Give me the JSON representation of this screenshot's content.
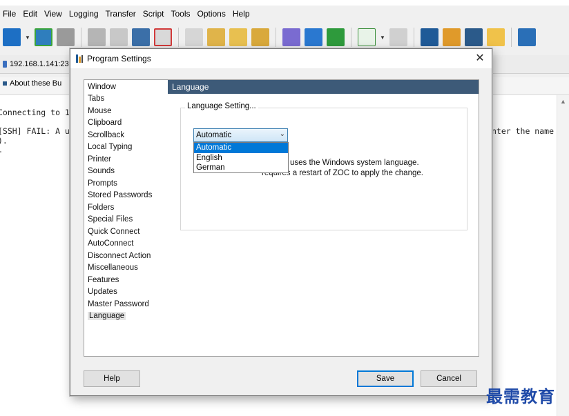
{
  "menubar": {
    "items": [
      "File",
      "Edit",
      "View",
      "Logging",
      "Transfer",
      "Script",
      "Tools",
      "Options",
      "Help"
    ]
  },
  "toolbar": {
    "icons": [
      "sort-az-icon",
      "connect-icon",
      "host-icon",
      "disconnect-icon",
      "close-connection-icon",
      "copy-icon",
      "delete-icon",
      "paste-icon",
      "clipboard-icon",
      "edit-icon",
      "clipboard-paste-icon",
      "download-icon",
      "upload-icon",
      "spellcheck-icon",
      "play-icon",
      "stop-icon",
      "add-icon",
      "settings-icon",
      "book-icon",
      "folder-icon",
      "terminal-icon"
    ]
  },
  "session": {
    "tab_label": "192.168.1.141:23",
    "button_label": "About these Bu"
  },
  "terminal": {
    "lines": [
      "Connecting to 1",
      "[SSH] FAIL: A u",
      ").",
      "-"
    ],
    "right_fragment": "nter the name"
  },
  "dialog": {
    "title": "Program Settings",
    "nav_items": [
      "Window",
      "Tabs",
      "Mouse",
      "Clipboard",
      "Scrollback",
      "Local Typing",
      "Printer",
      "Sounds",
      "Prompts",
      "Stored Passwords",
      "Folders",
      "Special Files",
      "Quick Connect",
      "AutoConnect",
      "Disconnect Action",
      "Miscellaneous",
      "Features",
      "Updates",
      "Master Password",
      "Language"
    ],
    "selected_nav": "Language",
    "panel_title": "Language",
    "group_label": "Language Setting...",
    "select_value": "Automatic",
    "options": [
      "Automatic",
      "English",
      "German"
    ],
    "note_line1": "uses the Windows system language.",
    "note_line2": "requires a restart of ZOC to apply the change.",
    "buttons": {
      "help": "Help",
      "save": "Save",
      "cancel": "Cancel"
    }
  },
  "watermark": "最需教育"
}
